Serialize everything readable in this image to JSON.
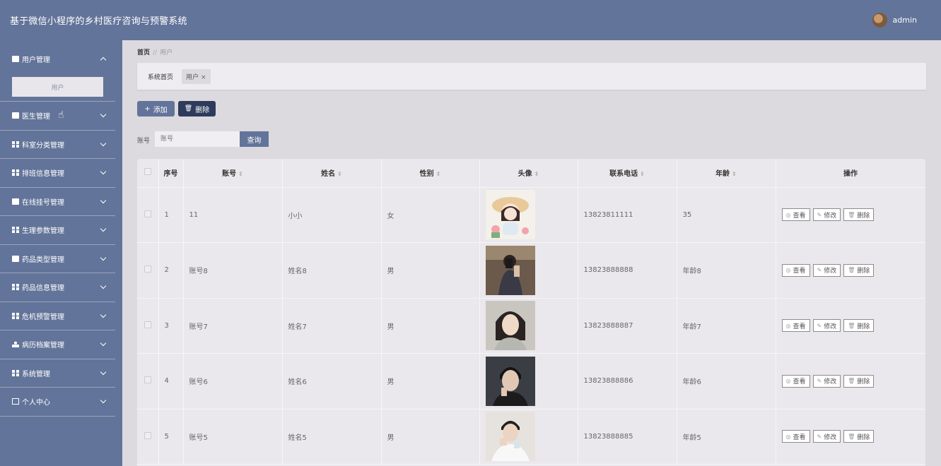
{
  "header": {
    "title": "基于微信小程序的乡村医疗咨询与预警系统",
    "user": "admin"
  },
  "sidebar": {
    "items": [
      {
        "label": "用户管理",
        "icon": "user-manage-icon",
        "expanded": true,
        "sub": [
          "用户"
        ]
      },
      {
        "label": "医生管理",
        "icon": "briefcase-icon"
      },
      {
        "label": "科室分类管理",
        "icon": "grid-icon"
      },
      {
        "label": "排班信息管理",
        "icon": "grid-icon"
      },
      {
        "label": "在线挂号管理",
        "icon": "ticket-icon"
      },
      {
        "label": "生理参数管理",
        "icon": "grid-icon"
      },
      {
        "label": "药品类型管理",
        "icon": "bookmark-icon"
      },
      {
        "label": "药品信息管理",
        "icon": "grid-icon"
      },
      {
        "label": "危机预警管理",
        "icon": "grid-icon"
      },
      {
        "label": "病历档案管理",
        "icon": "person-icon"
      },
      {
        "label": "系统管理",
        "icon": "grid-icon"
      },
      {
        "label": "个人中心",
        "icon": "card-icon"
      }
    ]
  },
  "breadcrumb": {
    "home": "首页",
    "sep": "//",
    "current": "用户"
  },
  "tabs": {
    "home": "系统首页",
    "user": "用户",
    "close": "×"
  },
  "toolbar": {
    "add": "添加",
    "add_icon": "+",
    "delete": "删除",
    "delete_icon": "🗑"
  },
  "search": {
    "label": "账号",
    "placeholder": "账号",
    "button": "查询"
  },
  "table": {
    "headers": [
      "序号",
      "账号",
      "姓名",
      "性别",
      "头像",
      "联系电话",
      "年龄",
      "操作"
    ],
    "sort_glyph": "⇕",
    "actions": {
      "view": "查看",
      "edit": "修改",
      "delete": "删除",
      "view_icon": "◎",
      "edit_icon": "✎",
      "delete_icon": "🗑"
    },
    "rows": [
      {
        "idx": "1",
        "account": "11",
        "name": "小小",
        "gender": "女",
        "phone": "13823811111",
        "age": "35",
        "avatar": "girl-illustration"
      },
      {
        "idx": "2",
        "account": "账号8",
        "name": "姓名8",
        "gender": "男",
        "phone": "13823888888",
        "age": "年龄8",
        "avatar": "mirror-selfie"
      },
      {
        "idx": "3",
        "account": "账号7",
        "name": "姓名7",
        "gender": "男",
        "phone": "13823888887",
        "age": "年龄7",
        "avatar": "short-hair-portrait"
      },
      {
        "idx": "4",
        "account": "账号6",
        "name": "姓名6",
        "gender": "男",
        "phone": "13823888886",
        "age": "年龄6",
        "avatar": "dark-portrait"
      },
      {
        "idx": "5",
        "account": "账号5",
        "name": "姓名5",
        "gender": "男",
        "phone": "13823888885",
        "age": "年龄5",
        "avatar": "white-shirt-portrait"
      }
    ]
  },
  "colors": {
    "primary": "#63749a",
    "dark": "#2e3b5c",
    "bg": "#dcdadf"
  }
}
